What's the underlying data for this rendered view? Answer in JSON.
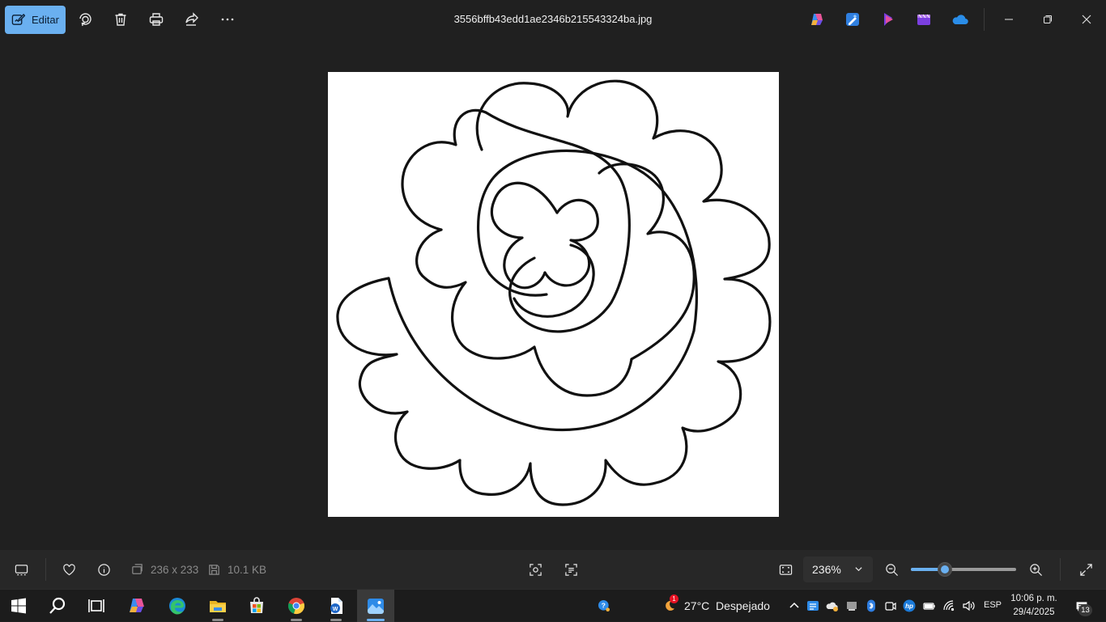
{
  "toolbar": {
    "edit_label": "Editar",
    "file_name": "3556bffb43edd1ae2346b215543324ba.jpg",
    "buttons": [
      "rotate-icon",
      "delete-icon",
      "print-icon",
      "share-icon",
      "more-icon"
    ],
    "app_icons": [
      "copilot-icon",
      "designer-icon",
      "clipchamp-purple-icon",
      "clipchamp-icon",
      "onedrive-icon"
    ]
  },
  "status": {
    "dimensions": "236 x 233",
    "file_size": "10.1 KB",
    "zoom_label": "236%",
    "zoom_slider_fraction": 0.32
  },
  "taskbar": {
    "weather_temp": "27°C",
    "weather_desc": "Despejado",
    "weather_badge": "1",
    "language": "ESP",
    "time": "10:06 p. m.",
    "date": "29/4/2025",
    "notification_count": "13",
    "apps": [
      "windows-start-icon",
      "search-icon",
      "task-view-icon",
      "copilot-icon",
      "edge-icon",
      "file-explorer-icon",
      "store-icon",
      "chrome-icon",
      "word-icon",
      "photos-icon"
    ]
  },
  "colors": {
    "accent": "#6ab0f0",
    "background": "#202020",
    "statusbar": "#272727",
    "taskbar": "#1c1c1c"
  }
}
